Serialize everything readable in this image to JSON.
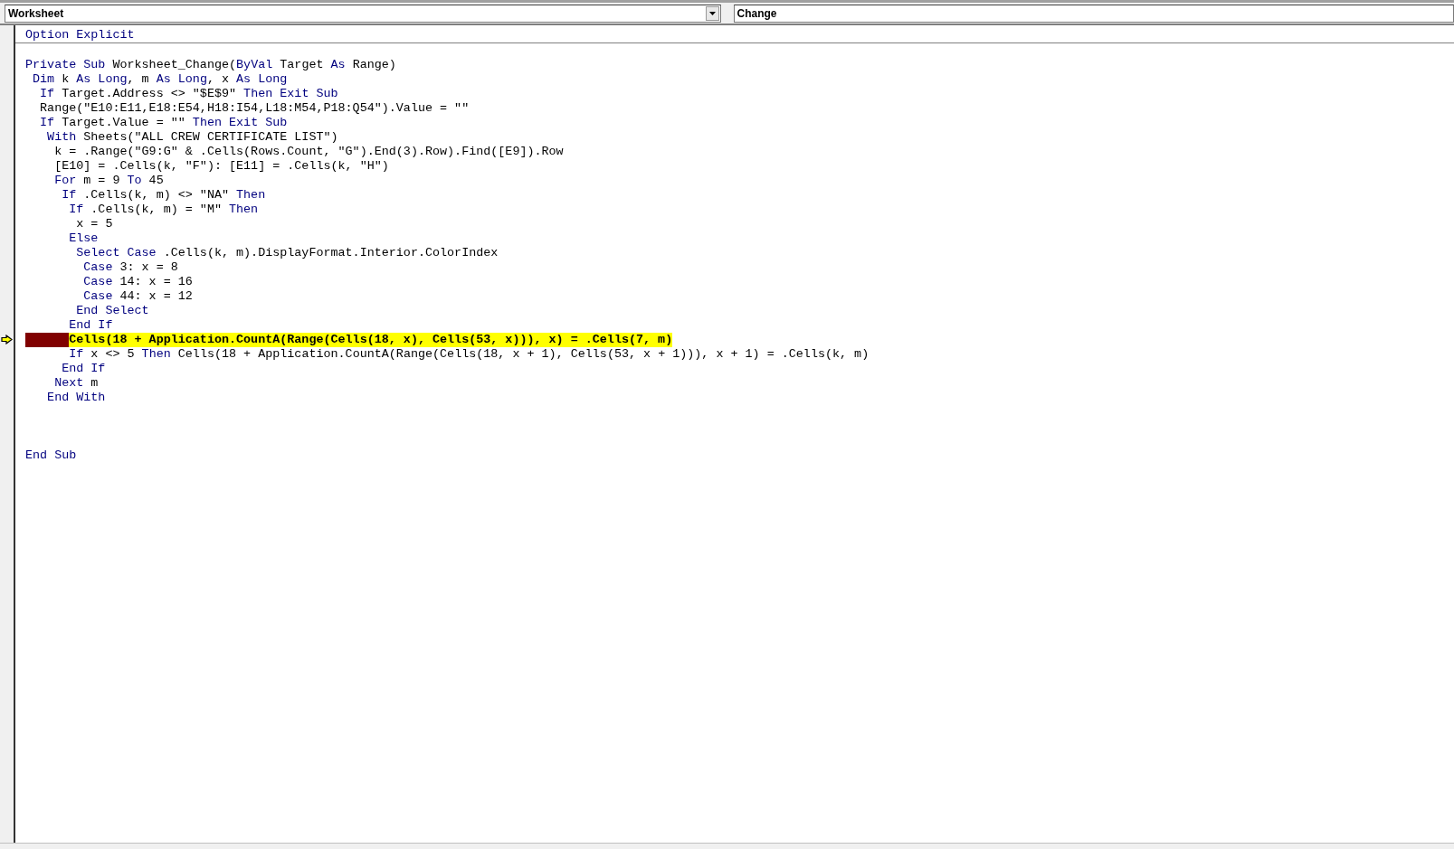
{
  "object_box": {
    "value": "Worksheet"
  },
  "procedure_box": {
    "value": "Change"
  },
  "sections": [
    {
      "lines": [
        {
          "kind": "code",
          "segments": [
            {
              "text": "Option Explicit",
              "kind": "kw"
            }
          ]
        }
      ]
    },
    {
      "lines": [
        {
          "kind": "blank"
        },
        {
          "kind": "code",
          "segments": [
            {
              "text": "Private Sub",
              "kind": "kw"
            },
            {
              "text": " Worksheet_Change(",
              "kind": "plain"
            },
            {
              "text": "ByVal",
              "kind": "kw"
            },
            {
              "text": " Target ",
              "kind": "plain"
            },
            {
              "text": "As",
              "kind": "kw"
            },
            {
              "text": " Range)",
              "kind": "plain"
            }
          ]
        },
        {
          "kind": "code",
          "segments": [
            {
              "text": " Dim",
              "kind": "kw"
            },
            {
              "text": " k ",
              "kind": "plain"
            },
            {
              "text": "As Long",
              "kind": "kw"
            },
            {
              "text": ", m ",
              "kind": "plain"
            },
            {
              "text": "As Long",
              "kind": "kw"
            },
            {
              "text": ", x ",
              "kind": "plain"
            },
            {
              "text": "As Long",
              "kind": "kw"
            }
          ]
        },
        {
          "kind": "code",
          "segments": [
            {
              "text": "  If",
              "kind": "kw"
            },
            {
              "text": " Target.Address <> \"$E$9\" ",
              "kind": "plain"
            },
            {
              "text": "Then Exit Sub",
              "kind": "kw"
            }
          ]
        },
        {
          "kind": "code",
          "segments": [
            {
              "text": "  Range(\"E10:E11,E18:E54,H18:I54,L18:M54,P18:Q54\").Value = \"\"",
              "kind": "plain"
            }
          ]
        },
        {
          "kind": "code",
          "segments": [
            {
              "text": "  If",
              "kind": "kw"
            },
            {
              "text": " Target.Value = \"\" ",
              "kind": "plain"
            },
            {
              "text": "Then Exit Sub",
              "kind": "kw"
            }
          ]
        },
        {
          "kind": "code",
          "segments": [
            {
              "text": "   With",
              "kind": "kw"
            },
            {
              "text": " Sheets(\"ALL CREW CERTIFICATE LIST\")",
              "kind": "plain"
            }
          ]
        },
        {
          "kind": "code",
          "segments": [
            {
              "text": "    k = .Range(\"G9:G\" & .Cells(Rows.Count, \"G\").End(3).Row).Find([E9]).Row",
              "kind": "plain"
            }
          ]
        },
        {
          "kind": "code",
          "segments": [
            {
              "text": "    [E10] = .Cells(k, \"F\"): [E11] = .Cells(k, \"H\")",
              "kind": "plain"
            }
          ]
        },
        {
          "kind": "code",
          "segments": [
            {
              "text": "    For",
              "kind": "kw"
            },
            {
              "text": " m = 9 ",
              "kind": "plain"
            },
            {
              "text": "To",
              "kind": "kw"
            },
            {
              "text": " 45",
              "kind": "plain"
            }
          ]
        },
        {
          "kind": "code",
          "segments": [
            {
              "text": "     If",
              "kind": "kw"
            },
            {
              "text": " .Cells(k, m) <> \"NA\" ",
              "kind": "plain"
            },
            {
              "text": "Then",
              "kind": "kw"
            }
          ]
        },
        {
          "kind": "code",
          "segments": [
            {
              "text": "      If",
              "kind": "kw"
            },
            {
              "text": " .Cells(k, m) = \"M\" ",
              "kind": "plain"
            },
            {
              "text": "Then",
              "kind": "kw"
            }
          ]
        },
        {
          "kind": "code",
          "segments": [
            {
              "text": "       x = 5",
              "kind": "plain"
            }
          ]
        },
        {
          "kind": "code",
          "segments": [
            {
              "text": "      Else",
              "kind": "kw"
            }
          ]
        },
        {
          "kind": "code",
          "segments": [
            {
              "text": "       Select Case",
              "kind": "kw"
            },
            {
              "text": " .Cells(k, m).DisplayFormat.Interior.ColorIndex",
              "kind": "plain"
            }
          ]
        },
        {
          "kind": "code",
          "segments": [
            {
              "text": "        Case",
              "kind": "kw"
            },
            {
              "text": " 3: x = 8",
              "kind": "plain"
            }
          ]
        },
        {
          "kind": "code",
          "segments": [
            {
              "text": "        Case",
              "kind": "kw"
            },
            {
              "text": " 14: x = 16",
              "kind": "plain"
            }
          ]
        },
        {
          "kind": "code",
          "segments": [
            {
              "text": "        Case",
              "kind": "kw"
            },
            {
              "text": " 44: x = 12",
              "kind": "plain"
            }
          ]
        },
        {
          "kind": "code",
          "segments": [
            {
              "text": "       End Select",
              "kind": "kw"
            }
          ]
        },
        {
          "kind": "code",
          "segments": [
            {
              "text": "      End If",
              "kind": "kw"
            }
          ]
        },
        {
          "kind": "current",
          "segments": [
            {
              "kind": "breakpoint"
            },
            {
              "text": "Cells(18 + Application.CountA(Range(Cells(18, x), Cells(53, x))), x) = .Cells(7, m)",
              "kind": "exec"
            }
          ]
        },
        {
          "kind": "code",
          "segments": [
            {
              "text": "      If",
              "kind": "kw"
            },
            {
              "text": " x <> 5 ",
              "kind": "plain"
            },
            {
              "text": "Then",
              "kind": "kw"
            },
            {
              "text": " Cells(18 + Application.CountA(Range(Cells(18, x + 1), Cells(53, x + 1))), x + 1) = .Cells(k, m)",
              "kind": "plain"
            }
          ]
        },
        {
          "kind": "code",
          "segments": [
            {
              "text": "     End If",
              "kind": "kw"
            }
          ]
        },
        {
          "kind": "code",
          "segments": [
            {
              "text": "    Next",
              "kind": "kw"
            },
            {
              "text": " m",
              "kind": "plain"
            }
          ]
        },
        {
          "kind": "code",
          "segments": [
            {
              "text": "   End With",
              "kind": "kw"
            }
          ]
        },
        {
          "kind": "blank"
        },
        {
          "kind": "blank"
        },
        {
          "kind": "blank"
        },
        {
          "kind": "code",
          "segments": [
            {
              "text": "End Sub",
              "kind": "kw"
            }
          ]
        }
      ]
    }
  ]
}
